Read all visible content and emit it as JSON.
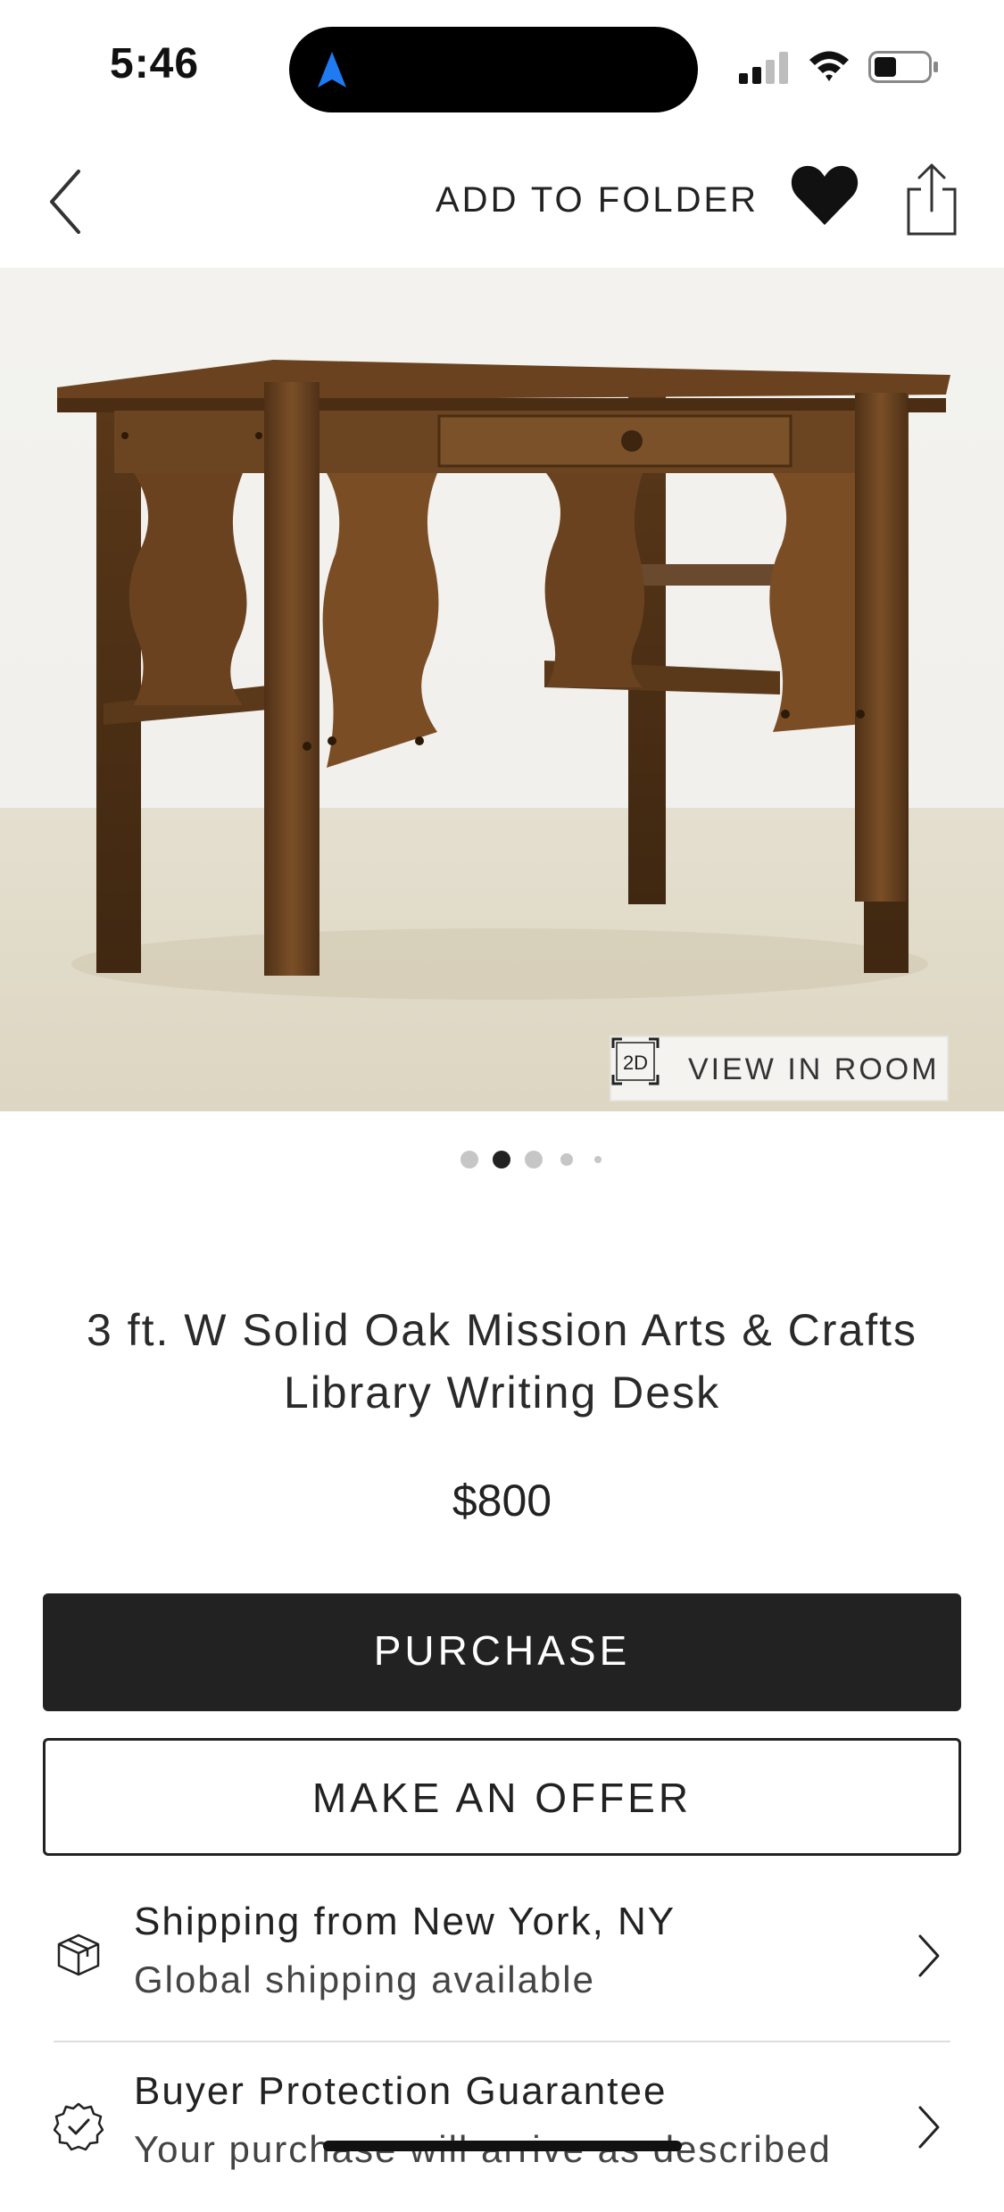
{
  "status_bar": {
    "time": "5:46"
  },
  "nav": {
    "add_to_folder_label": "ADD TO FOLDER",
    "icons": [
      "chevron-left-icon",
      "heart-icon",
      "share-icon"
    ]
  },
  "gallery": {
    "view_in_room_badge": "2D",
    "view_in_room_label": "VIEW IN ROOM",
    "image_count_dots": 5,
    "active_index": 1
  },
  "product": {
    "title": "3 ft. W Solid Oak Mission Arts & Crafts Library Writing Desk",
    "price": "$800"
  },
  "actions": {
    "purchase_label": "PURCHASE",
    "offer_label": "MAKE AN OFFER"
  },
  "info": [
    {
      "icon": "package-icon",
      "title": "Shipping from New York, NY",
      "subtitle": "Global shipping available"
    },
    {
      "icon": "verified-badge-icon",
      "title": "Buyer Protection Guarantee",
      "subtitle": "Your purchase will arrive as described"
    }
  ],
  "colors": {
    "primary": "#222222",
    "background": "#ffffff",
    "location_arrow": "#1e7bf2",
    "wood": "#6b4420"
  }
}
